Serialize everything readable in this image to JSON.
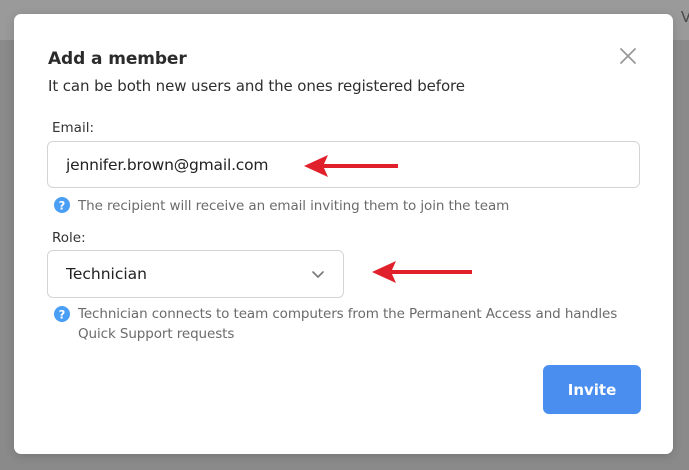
{
  "background": {
    "partial_text": "Vi"
  },
  "dialog": {
    "title": "Add a member",
    "subtitle": "It can be both new users and the ones registered before",
    "close_icon": "close-icon",
    "email": {
      "label": "Email:",
      "value": "jennifer.brown@gmail.com",
      "hint": "The recipient will receive an email inviting them to join the team"
    },
    "role": {
      "label": "Role:",
      "selected": "Technician",
      "hint": "Technician connects to team computers from the Permanent Access and handles Quick Support requests"
    },
    "invite_label": "Invite"
  },
  "annotations": {
    "arrow_color": "#e0212b",
    "hint_icon_color": "#4a9ff5",
    "accent": "#4a8ff0"
  }
}
